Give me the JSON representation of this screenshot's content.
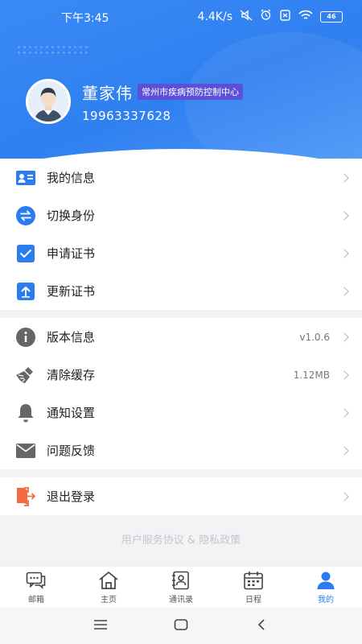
{
  "status_bar": {
    "time": "下午3:45",
    "speed": "4.4K/s",
    "battery": "46",
    "icons": [
      "muted-icon",
      "alarm-icon",
      "sim-off-icon",
      "wifi-icon",
      "battery-icon"
    ]
  },
  "profile": {
    "name": "董家伟",
    "organization": "常州市疾病预防控制中心",
    "phone": "19963337628"
  },
  "menu_groups": [
    [
      {
        "label": "我的信息",
        "icon": "id-card-icon"
      },
      {
        "label": "切换身份",
        "icon": "switch-icon"
      },
      {
        "label": "申请证书",
        "icon": "check-box-icon"
      },
      {
        "label": "更新证书",
        "icon": "upload-icon"
      }
    ],
    [
      {
        "label": "版本信息",
        "icon": "info-icon",
        "value": "v1.0.6"
      },
      {
        "label": "清除缓存",
        "icon": "broom-icon",
        "value": "1.12MB"
      },
      {
        "label": "通知设置",
        "icon": "bell-icon"
      },
      {
        "label": "问题反馈",
        "icon": "mail-icon"
      }
    ],
    [
      {
        "label": "退出登录",
        "icon": "logout-icon"
      }
    ]
  ],
  "footer": {
    "agreement_text": "用户服务协议 & 隐私政策"
  },
  "tabs": [
    {
      "label": "邮箱",
      "icon": "chat-icon"
    },
    {
      "label": "主页",
      "icon": "home-icon"
    },
    {
      "label": "通讯录",
      "icon": "contacts-icon"
    },
    {
      "label": "日程",
      "icon": "calendar-icon"
    },
    {
      "label": "我的",
      "icon": "user-icon",
      "active": true
    }
  ],
  "colors": {
    "primary": "#2B7CF0",
    "header_gradient_start": "#3A8BF5",
    "badge": "#5C50D8",
    "logout_icon": "#F36B45",
    "icon_gray": "#666666"
  }
}
